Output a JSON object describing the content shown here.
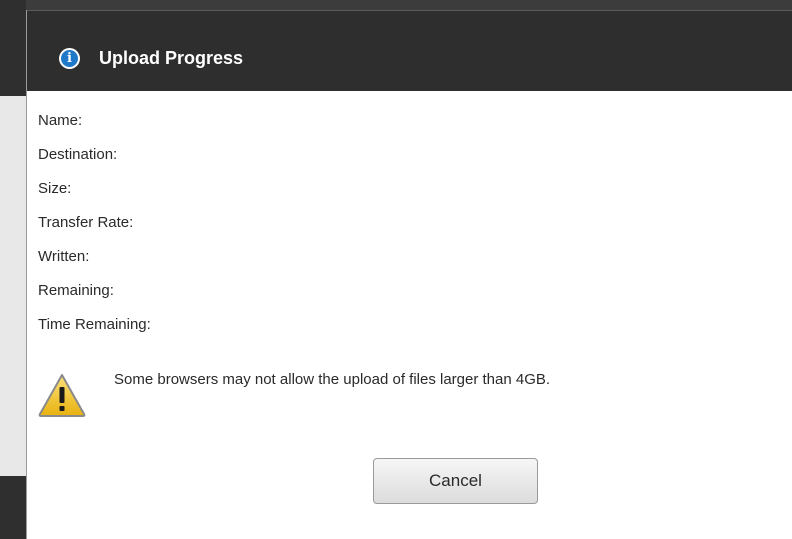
{
  "dialog": {
    "title": "Upload Progress",
    "title_icon": "info-icon",
    "fields": [
      {
        "label": "Name:",
        "value": ""
      },
      {
        "label": "Destination:",
        "value": ""
      },
      {
        "label": "Size:",
        "value": ""
      },
      {
        "label": "Transfer Rate:",
        "value": ""
      },
      {
        "label": "Written:",
        "value": ""
      },
      {
        "label": "Remaining:",
        "value": ""
      },
      {
        "label": "Time Remaining:",
        "value": ""
      }
    ],
    "warning": {
      "icon": "warning-icon",
      "text": "Some browsers may not allow the upload of files larger than 4GB."
    },
    "cancel_label": "Cancel"
  },
  "colors": {
    "titlebar": "#2e2e2e",
    "info_icon": "#1f78c8",
    "warning_yellow": "#f0c419"
  }
}
